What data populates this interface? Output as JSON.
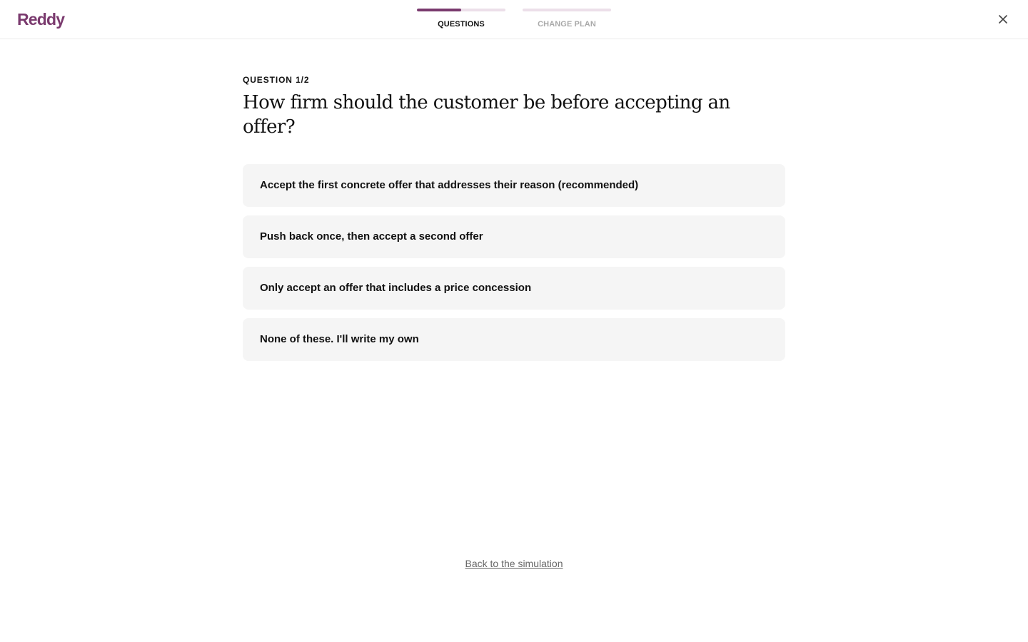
{
  "app": {
    "logo_text": "Reddy",
    "brand_color": "#7a3a6e"
  },
  "stepper": {
    "steps": [
      {
        "label": "QUESTIONS",
        "progress": 0.5,
        "active": true
      },
      {
        "label": "CHANGE PLAN",
        "progress": 0,
        "active": false
      }
    ]
  },
  "header": {
    "close_icon": "close-icon"
  },
  "question": {
    "counter": "QUESTION 1/2",
    "text": "How firm should the customer be before accepting an offer?",
    "options": [
      {
        "label": "Accept the first concrete offer that addresses their reason (recommended)"
      },
      {
        "label": "Push back once, then accept a second offer"
      },
      {
        "label": "Only accept an offer that includes a price concession"
      },
      {
        "label": "None of these. I'll write my own"
      }
    ]
  },
  "footer": {
    "back_link": "Back to the simulation"
  }
}
